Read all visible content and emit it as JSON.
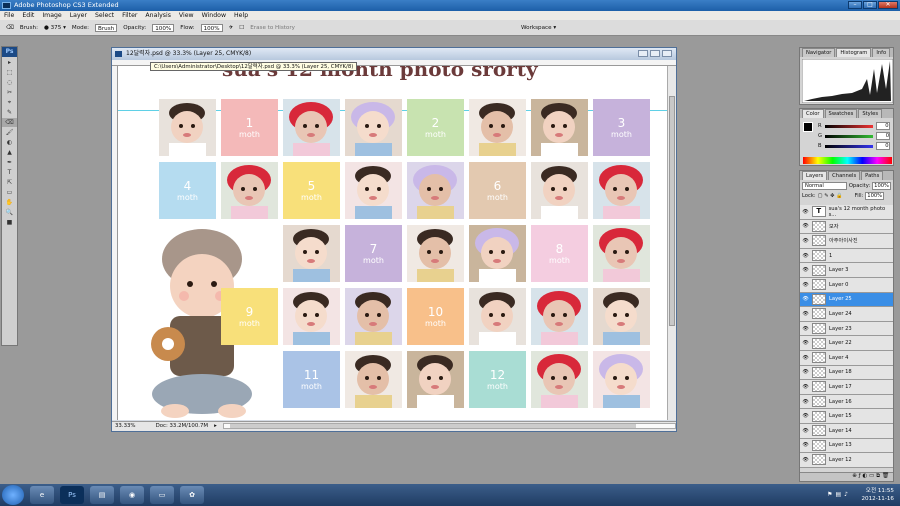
{
  "window": {
    "title": "Adobe Photoshop CS3 Extended"
  },
  "menu": [
    "File",
    "Edit",
    "Image",
    "Layer",
    "Select",
    "Filter",
    "Analysis",
    "View",
    "Window",
    "Help"
  ],
  "options": {
    "brush_label": "Brush:",
    "brush_size": "375",
    "mode_label": "Mode:",
    "mode_value": "Brush",
    "opacity_label": "Opacity:",
    "opacity_value": "100%",
    "flow_label": "Flow:",
    "flow_value": "100%",
    "erase_history": "Erase to History",
    "workspace": "Workspace ▾"
  },
  "doc": {
    "tab_title": "12달력자.psd @ 33.3% (Layer 25, CMYK/8)",
    "path_tooltip": "C:\\Users\\Administrator\\Desktop\\12달력자.psd @ 33.3% (Layer 25, CMYK/8)",
    "zoom": "33.33%",
    "doc_size": "Doc: 33.2M/100.7M"
  },
  "poster": {
    "title": "sua's 12 month photo srorty",
    "month_word": "moth",
    "tiles": [
      {
        "n": "1",
        "color": "#f4b9b9"
      },
      {
        "n": "2",
        "color": "#c8e3b0"
      },
      {
        "n": "3",
        "color": "#c6b2db"
      },
      {
        "n": "4",
        "color": "#b5dcf0"
      },
      {
        "n": "5",
        "color": "#f8e07a"
      },
      {
        "n": "6",
        "color": "#e3c9b0"
      },
      {
        "n": "7",
        "color": "#c6b2db"
      },
      {
        "n": "8",
        "color": "#f4cde0"
      },
      {
        "n": "9",
        "color": "#f8e07a"
      },
      {
        "n": "10",
        "color": "#f8c08a"
      },
      {
        "n": "11",
        "color": "#aac3e6"
      },
      {
        "n": "12",
        "color": "#a9ddd4"
      }
    ]
  },
  "panels": {
    "nav_tabs": [
      "Navigator",
      "Histogram",
      "Info"
    ],
    "color_tabs": [
      "Color",
      "Swatches",
      "Styles"
    ],
    "color_channels": [
      {
        "label": "R",
        "value": "0"
      },
      {
        "label": "G",
        "value": "0"
      },
      {
        "label": "B",
        "value": "0"
      }
    ],
    "layer_tabs": [
      "Layers",
      "Channels",
      "Paths"
    ],
    "blend_mode": "Normal",
    "opacity_label": "Opacity:",
    "opacity_value": "100%",
    "lock_label": "Lock:",
    "fill_label": "Fill:",
    "fill_value": "100%",
    "layers": [
      "sua's 12 month photo s...",
      "모자",
      "아주아이사진",
      "1",
      "Layer 3",
      "Layer 0",
      "Layer 25",
      "Layer 24",
      "Layer 23",
      "Layer 22",
      "Layer 4",
      "Layer 18",
      "Layer 17",
      "Layer 16",
      "Layer 15",
      "Layer 14",
      "Layer 13",
      "Layer 12"
    ],
    "selected_layer": "Layer 25"
  },
  "taskbar": {
    "time": "오전 11:55",
    "date": "2012-11-16"
  }
}
